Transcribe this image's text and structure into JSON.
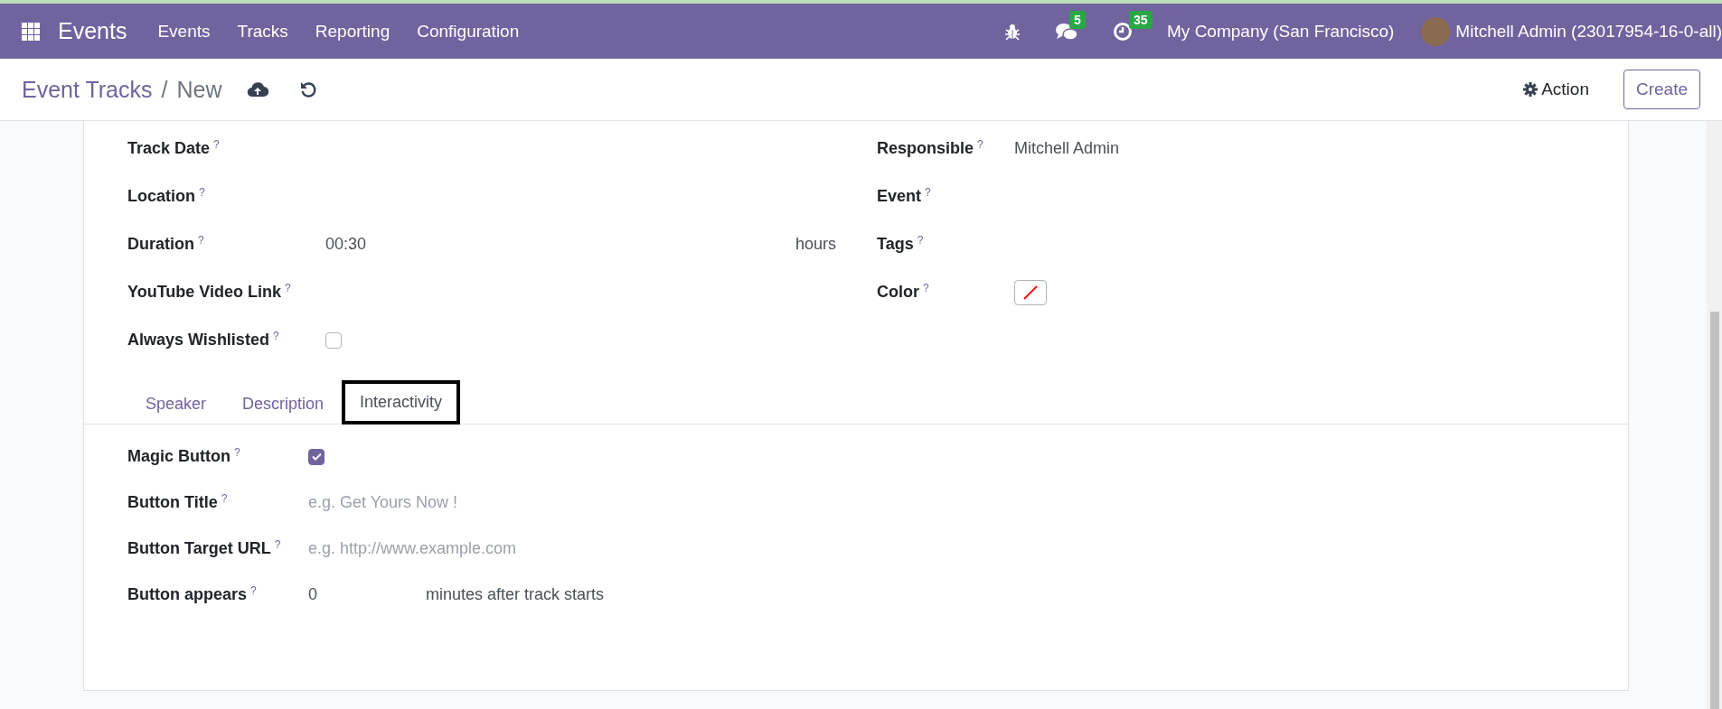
{
  "navbar": {
    "app_name": "Events",
    "menu": [
      "Events",
      "Tracks",
      "Reporting",
      "Configuration"
    ],
    "messages_count": "5",
    "activities_count": "35",
    "company": "My Company (San Francisco)",
    "user": "Mitchell Admin (23017954-16-0-all)"
  },
  "control_panel": {
    "breadcrumb_parent": "Event Tracks",
    "breadcrumb_separator": "/",
    "breadcrumb_current": "New",
    "action": "Action",
    "create": "Create"
  },
  "left_fields": [
    {
      "label": "Track Date",
      "help": "?",
      "kind": "text"
    },
    {
      "label": "Location",
      "help": "?",
      "kind": "text"
    },
    {
      "label": "Duration",
      "help": "?",
      "kind": "duration",
      "value": "00:30",
      "unit": "hours"
    },
    {
      "label": "YouTube Video Link",
      "help": "?",
      "kind": "text"
    },
    {
      "label": "Always Wishlisted",
      "help": "?",
      "kind": "checkbox",
      "checked": false
    }
  ],
  "right_fields": [
    {
      "label": "Responsible",
      "help": "?",
      "kind": "text",
      "value": "Mitchell Admin"
    },
    {
      "label": "Event",
      "help": "?",
      "kind": "text"
    },
    {
      "label": "Tags",
      "help": "?",
      "kind": "text"
    },
    {
      "label": "Color",
      "help": "?",
      "kind": "color"
    }
  ],
  "tabs": [
    {
      "label": "Speaker",
      "selected": false
    },
    {
      "label": "Description",
      "selected": false
    },
    {
      "label": "Interactivity",
      "selected": true
    }
  ],
  "tab_fields": [
    {
      "label": "Magic Button",
      "help": "?",
      "kind": "checkbox",
      "checked": true
    },
    {
      "label": "Button Title",
      "help": "?",
      "kind": "input",
      "placeholder": "e.g. Get Yours Now !"
    },
    {
      "label": "Button Target URL",
      "help": "?",
      "kind": "input",
      "placeholder": "e.g. http://www.example.com"
    },
    {
      "label": "Button appears",
      "help": "?",
      "kind": "number",
      "value": "0",
      "suffix": "minutes after track starts"
    }
  ]
}
